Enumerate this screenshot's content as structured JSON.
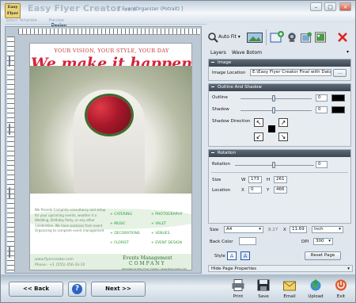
{
  "app": {
    "title": "Easy Flyer Creator",
    "version": "v3.0",
    "document": "[ EventOrganizer (Potrait) ]",
    "logo_text": "Easy Flyer"
  },
  "steps": [
    "Select Template",
    "Design",
    "Preview"
  ],
  "active_step": "Design",
  "flyer": {
    "tagline": "YOUR VISION, YOUR STYLE, YOUR DAY",
    "headline": "We make it happen",
    "intro": "We Provide Complete consultancy and setup for your upcoming events, weather it a Wedding, Birthday Party, or any other Celebration. We have solutions from event Organizing to complete event management",
    "services": [
      "+ CATERING",
      "+ PHOTOGRAPHY",
      "+ MUSIC",
      "+ VALET",
      "+ DECORATIONS",
      "+ VENUES",
      "+ FLORIST",
      "+ EVENT DESIGN"
    ],
    "website": "www.flyercreator.com",
    "phone": "Phone:- +1 (555) 456-33-10",
    "company_line1": "Events Management",
    "company_line2": "COMPANY",
    "company_url": "Template by Easy Flyer Creator | www.flyercreator.com"
  },
  "toolbar": {
    "auto_fit": "Auto Fit"
  },
  "layers": {
    "label": "Layers",
    "value": "Wave Botom"
  },
  "image_section": {
    "title": "Image",
    "location_label": "Image Location",
    "location_value": "E:\\Easy Flyer Creator Final with Data\\",
    "browse": "..."
  },
  "outline_section": {
    "title": "Outline And Shadow",
    "outline_label": "Outline",
    "outline_value": "0",
    "shadow_label": "Shadow",
    "shadow_value": "0",
    "direction_label": "Shadow Direction"
  },
  "rotation_section": {
    "title": "Rotation",
    "rotation_label": "Rotation",
    "rotation_value": "0",
    "size_label": "Size",
    "w_label": "W",
    "w_value": "173",
    "h_label": "H",
    "h_value": "261",
    "location_label": "Location",
    "x_label": "X",
    "x_value": "0",
    "y_label": "Y",
    "y_value": "466"
  },
  "page_settings": {
    "size_label": "Size",
    "size_value": "A4",
    "width": "8.27",
    "x": "X",
    "height": "11.69",
    "unit": "Inch",
    "back_color_label": "Back Color",
    "dpi_label": "DPI",
    "dpi_value": "300",
    "style_label": "Style",
    "reset_label": "Reset Page",
    "hide_props": "Hide Page Properties"
  },
  "footer": {
    "back": "<< Back",
    "next": "Next >>",
    "help": "?",
    "actions": [
      "Print",
      "Save",
      "Email",
      "Upload",
      "Exit"
    ]
  },
  "colors": {
    "headline": "#d6233a",
    "services": "#2a9a3a",
    "section_header": "#4b5560"
  }
}
